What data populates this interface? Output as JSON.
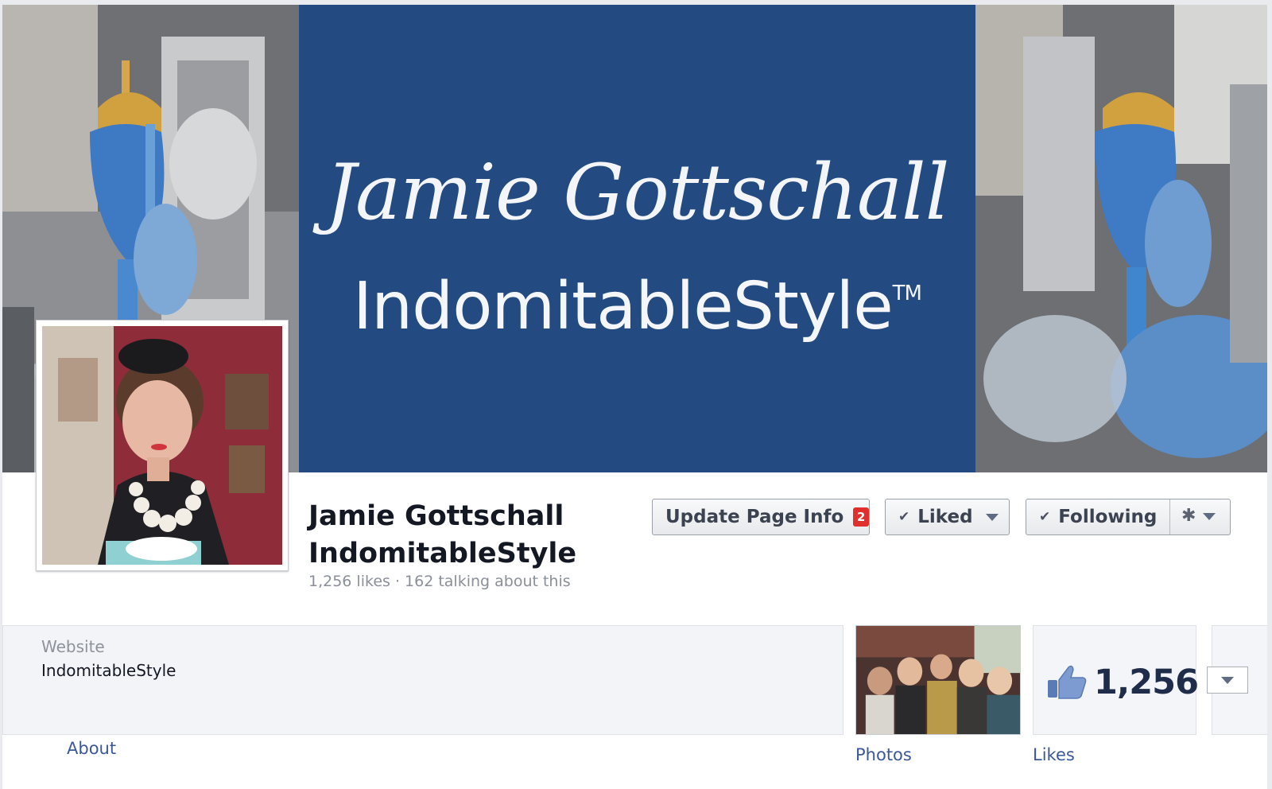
{
  "cover": {
    "script_text": "Jamie Gottschall",
    "brand_text": "IndomitableStyle",
    "trademark": "TM",
    "banner_color": "#234b82"
  },
  "profile": {
    "name_line1": "Jamie Gottschall",
    "name_line2": "IndomitableStyle",
    "stats": "1,256 likes · 162 talking about this"
  },
  "actions": {
    "update_label": "Update Page Info",
    "update_badge": "2",
    "liked_label": "Liked",
    "following_label": "Following",
    "check_icon": "check-icon",
    "gear_icon": "gear-icon",
    "badge_color": "#e0302d"
  },
  "info": {
    "label": "Website",
    "value": "IndomitableStyle",
    "about_link": "About"
  },
  "apps": {
    "photos_label": "Photos",
    "likes_label": "Likes",
    "likes_count": "1,256"
  },
  "colors": {
    "link": "#3b5998",
    "text": "#141823",
    "muted": "#8a8f99"
  }
}
